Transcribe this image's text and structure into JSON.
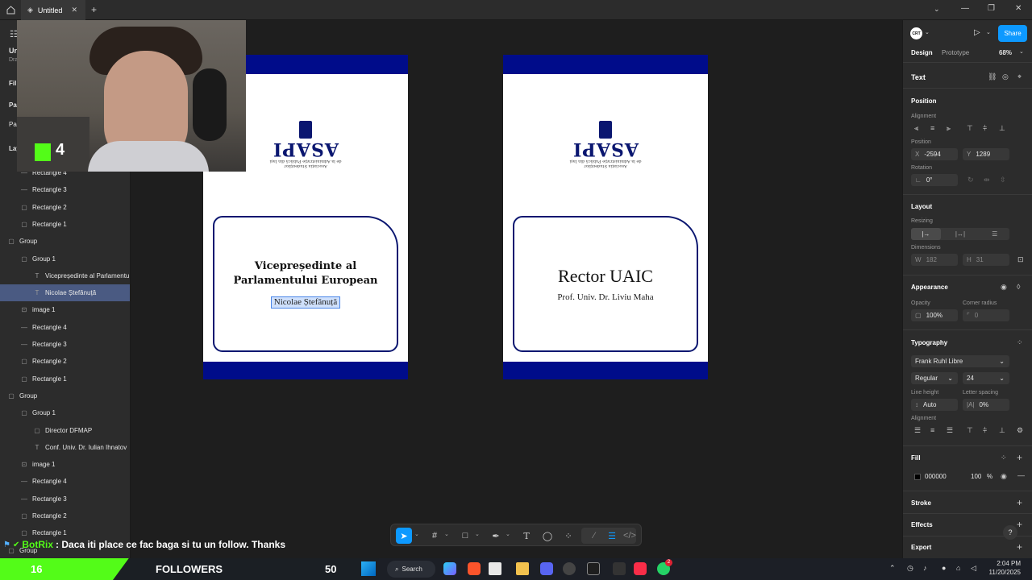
{
  "titlebar": {
    "tab_title": "Untitled",
    "home_icon": "home-icon",
    "add_tab": "+"
  },
  "left_panel": {
    "file_name_partial": "Ur",
    "drafts_partial": "Dra",
    "pages_partial_1": "Pa",
    "pages_partial_2": "Pa",
    "file_partial": "Fil",
    "layers_partial": "Lay",
    "layers": [
      {
        "label": "Rectangle 4",
        "icon": "line",
        "indent": 2
      },
      {
        "label": "Rectangle 3",
        "icon": "line",
        "indent": 2
      },
      {
        "label": "Rectangle 2",
        "icon": "rect",
        "indent": 2
      },
      {
        "label": "Rectangle 1",
        "icon": "rect",
        "indent": 2
      },
      {
        "label": "Group",
        "icon": "group",
        "indent": 1
      },
      {
        "label": "Group 1",
        "icon": "group",
        "indent": 2
      },
      {
        "label": "Vicepreședinte al Parlamentu",
        "icon": "text",
        "indent": 3
      },
      {
        "label": "Nicolae Ștefănuță",
        "icon": "text",
        "indent": 3,
        "selected": true
      },
      {
        "label": "image 1",
        "icon": "image",
        "indent": 2
      },
      {
        "label": "Rectangle 4",
        "icon": "line",
        "indent": 2
      },
      {
        "label": "Rectangle 3",
        "icon": "line",
        "indent": 2
      },
      {
        "label": "Rectangle 2",
        "icon": "rect",
        "indent": 2
      },
      {
        "label": "Rectangle 1",
        "icon": "rect",
        "indent": 2
      },
      {
        "label": "Group",
        "icon": "group",
        "indent": 1
      },
      {
        "label": "Group 1",
        "icon": "group",
        "indent": 2
      },
      {
        "label": "Director DFMAP",
        "icon": "rect",
        "indent": 3
      },
      {
        "label": "Conf. Univ. Dr. Iulian Ihnatov",
        "icon": "text",
        "indent": 3
      },
      {
        "label": "image 1",
        "icon": "image",
        "indent": 2
      },
      {
        "label": "Rectangle 4",
        "icon": "line",
        "indent": 2
      },
      {
        "label": "Rectangle 3",
        "icon": "line",
        "indent": 2
      },
      {
        "label": "Rectangle 2",
        "icon": "rect",
        "indent": 2
      },
      {
        "label": "Rectangle 1",
        "icon": "rect",
        "indent": 2
      },
      {
        "label": "Group",
        "icon": "group",
        "indent": 1
      }
    ]
  },
  "canvas": {
    "card1": {
      "logo_text": "ASAPI",
      "logo_caption_1": "Asociația Studenților",
      "logo_caption_2": "de la Administrație Publică din Iași",
      "title_line_1": "Vicepreședinte al",
      "title_line_2": "Parlamentului European",
      "name": "Nicolae Ștefănuță"
    },
    "card2": {
      "logo_text": "ASAPI",
      "logo_caption_1": "Asociația Studenților",
      "logo_caption_2": "de la Administrație Publică din Iași",
      "title": "Rector UAIC",
      "name": "Prof. Univ. Dr. Liviu Maha"
    },
    "colors": {
      "band": "#000c8a",
      "border": "#0a1670",
      "selection": "#4a86e8"
    }
  },
  "right_panel": {
    "avatar": "CRT",
    "share": "Share",
    "tab_design": "Design",
    "tab_prototype": "Prototype",
    "zoom": "68%",
    "section_text": "Text",
    "position": "Position",
    "alignment": "Alignment",
    "position_label": "Position",
    "x_label": "X",
    "x_value": "-2594",
    "y_label": "Y",
    "y_value": "1289",
    "rotation": "Rotation",
    "rotation_value": "0°",
    "layout": "Layout",
    "resizing": "Resizing",
    "dimensions": "Dimensions",
    "w_label": "W",
    "w_value": "182",
    "h_label": "H",
    "h_value": "31",
    "appearance": "Appearance",
    "opacity": "Opacity",
    "opacity_value": "100%",
    "corner_radius": "Corner radius",
    "corner_value": "0",
    "typography": "Typography",
    "font": "Frank Ruhl Libre",
    "weight": "Regular",
    "size": "24",
    "line_height": "Line height",
    "line_height_value": "Auto",
    "letter_spacing": "Letter spacing",
    "letter_spacing_value": "0%",
    "alignment2": "Alignment",
    "fill": "Fill",
    "fill_hex": "000000",
    "fill_opacity": "100",
    "fill_pct": "%",
    "stroke": "Stroke",
    "effects": "Effects",
    "export": "Export",
    "help": "?"
  },
  "overlay": {
    "webcam_badge": "4",
    "chat_user": "BotRix",
    "chat_message": ": Daca iti place ce fac baga si tu un follow. Thanks",
    "followers_count": "16",
    "followers_label": "FOLLOWERS",
    "followers_goal": "50"
  },
  "taskbar": {
    "search": "Search",
    "time": "2:04 PM",
    "date": "11/20/2025",
    "whatsapp_badge": "2"
  }
}
